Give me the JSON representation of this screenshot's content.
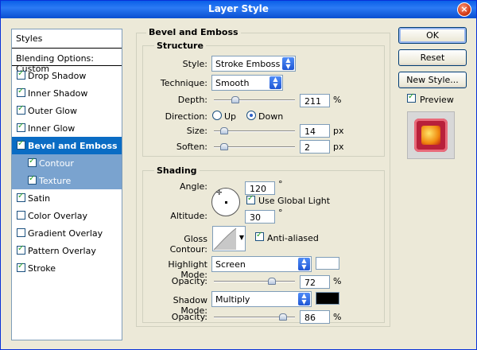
{
  "window": {
    "title": "Layer Style",
    "close": "×"
  },
  "styles_list": {
    "header": "Styles",
    "blending": "Blending Options: Custom",
    "items": [
      {
        "label": "Drop Shadow",
        "checked": true
      },
      {
        "label": "Inner Shadow",
        "checked": true
      },
      {
        "label": "Outer Glow",
        "checked": true
      },
      {
        "label": "Inner Glow",
        "checked": true
      },
      {
        "label": "Bevel and Emboss",
        "checked": true,
        "selected": true
      },
      {
        "label": "Contour",
        "checked": true,
        "sub": true
      },
      {
        "label": "Texture",
        "checked": true,
        "sub": true
      },
      {
        "label": "Satin",
        "checked": true
      },
      {
        "label": "Color Overlay",
        "checked": false
      },
      {
        "label": "Gradient Overlay",
        "checked": false
      },
      {
        "label": "Pattern Overlay",
        "checked": true
      },
      {
        "label": "Stroke",
        "checked": true
      }
    ]
  },
  "bevel": {
    "title": "Bevel and Emboss",
    "structure": "Structure",
    "style_label": "Style:",
    "style_value": "Stroke Emboss",
    "technique_label": "Technique:",
    "technique_value": "Smooth",
    "depth_label": "Depth:",
    "depth_value": "211",
    "depth_unit": "%",
    "direction_label": "Direction:",
    "dir_up": "Up",
    "dir_down": "Down",
    "size_label": "Size:",
    "size_value": "14",
    "size_unit": "px",
    "soften_label": "Soften:",
    "soften_value": "2",
    "soften_unit": "px"
  },
  "shading": {
    "title": "Shading",
    "angle_label": "Angle:",
    "angle_value": "120",
    "angle_unit": "°",
    "global_light": "Use Global Light",
    "altitude_label": "Altitude:",
    "altitude_value": "30",
    "altitude_unit": "°",
    "gloss_label": "Gloss Contour:",
    "anti_aliased": "Anti-aliased",
    "highlight_label": "Highlight Mode:",
    "highlight_value": "Screen",
    "highlight_color": "#ffffff",
    "hl_opacity_label": "Opacity:",
    "hl_opacity_value": "72",
    "hl_opacity_unit": "%",
    "shadow_label": "Shadow Mode:",
    "shadow_value": "Multiply",
    "shadow_color": "#000000",
    "sh_opacity_label": "Opacity:",
    "sh_opacity_value": "86",
    "sh_opacity_unit": "%"
  },
  "buttons": {
    "ok": "OK",
    "reset": "Reset",
    "new_style": "New Style...",
    "preview": "Preview"
  }
}
